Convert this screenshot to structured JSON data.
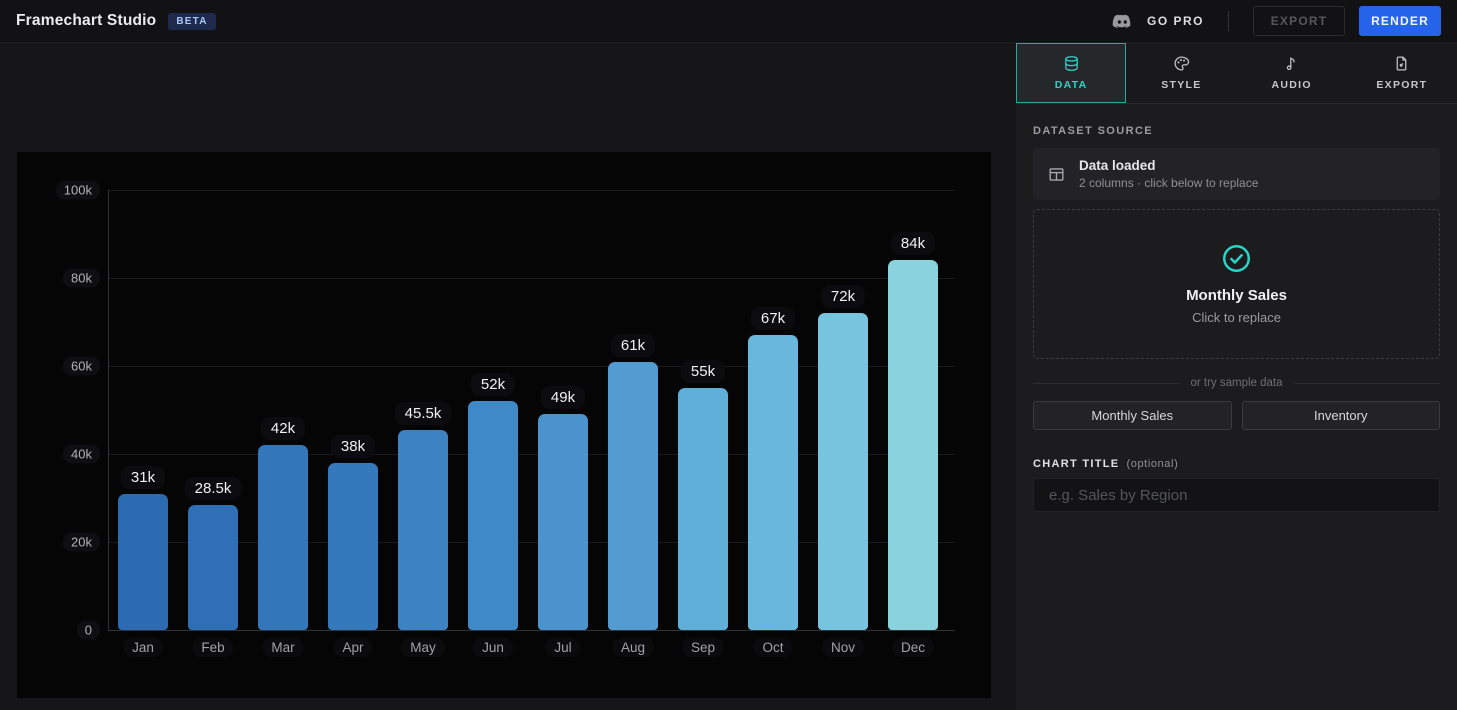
{
  "app": {
    "title": "Framechart Studio",
    "badge": "BETA",
    "accent_teal": "#2bd4c8",
    "accent_blue": "#2563eb"
  },
  "topbar": {
    "go_pro_label": "GO PRO",
    "export_label": "EXPORT",
    "render_label": "RENDER",
    "discord_icon": "discord-logo"
  },
  "sidebar": {
    "tabs": [
      {
        "label": "DATA",
        "icon": "database-icon",
        "active": true
      },
      {
        "label": "STYLE",
        "icon": "palette-icon",
        "active": false
      },
      {
        "label": "AUDIO",
        "icon": "music-note-icon",
        "active": false
      },
      {
        "label": "EXPORT",
        "icon": "file-export-icon",
        "active": false
      }
    ],
    "dataset_source": {
      "section_label": "DATASET SOURCE",
      "status_icon": "table-icon",
      "status_title": "Data loaded",
      "status_subtitle": "2 columns · click below to replace",
      "dropzone_icon": "check-circle-icon",
      "dropzone_title": "Monthly Sales",
      "dropzone_subtitle": "Click to replace"
    },
    "sample_data": {
      "divider_label": "or try sample data",
      "buttons": [
        "Monthly Sales",
        "Inventory"
      ]
    },
    "chart_title_field": {
      "label": "CHART TITLE",
      "label_suffix": "(optional)",
      "placeholder": "e.g. Sales by Region",
      "value": ""
    }
  },
  "chart_data": {
    "type": "bar",
    "title": "",
    "xlabel": "",
    "ylabel": "",
    "categories": [
      "Jan",
      "Feb",
      "Mar",
      "Apr",
      "May",
      "Jun",
      "Jul",
      "Aug",
      "Sep",
      "Oct",
      "Nov",
      "Dec"
    ],
    "values": [
      31000,
      28500,
      42000,
      38000,
      45500,
      52000,
      49000,
      61000,
      55000,
      67000,
      72000,
      84000
    ],
    "value_labels": [
      "31k",
      "28.5k",
      "42k",
      "38k",
      "45.5k",
      "52k",
      "49k",
      "61k",
      "55k",
      "67k",
      "72k",
      "84k"
    ],
    "y_ticks": [
      {
        "value": 0,
        "label": "0"
      },
      {
        "value": 20000,
        "label": "20k"
      },
      {
        "value": 40000,
        "label": "40k"
      },
      {
        "value": 60000,
        "label": "60k"
      },
      {
        "value": 80000,
        "label": "80k"
      },
      {
        "value": 100000,
        "label": "100k"
      }
    ],
    "ylim": [
      0,
      100000
    ],
    "grid": true,
    "legend": false,
    "bar_colors": [
      "#2c6ab2",
      "#2e6fb5",
      "#3476ba",
      "#3579bd",
      "#3d83c3",
      "#4089c7",
      "#4b93cd",
      "#539cd2",
      "#5fafd9",
      "#69b7dc",
      "#77c4de",
      "#8ad2de"
    ]
  }
}
